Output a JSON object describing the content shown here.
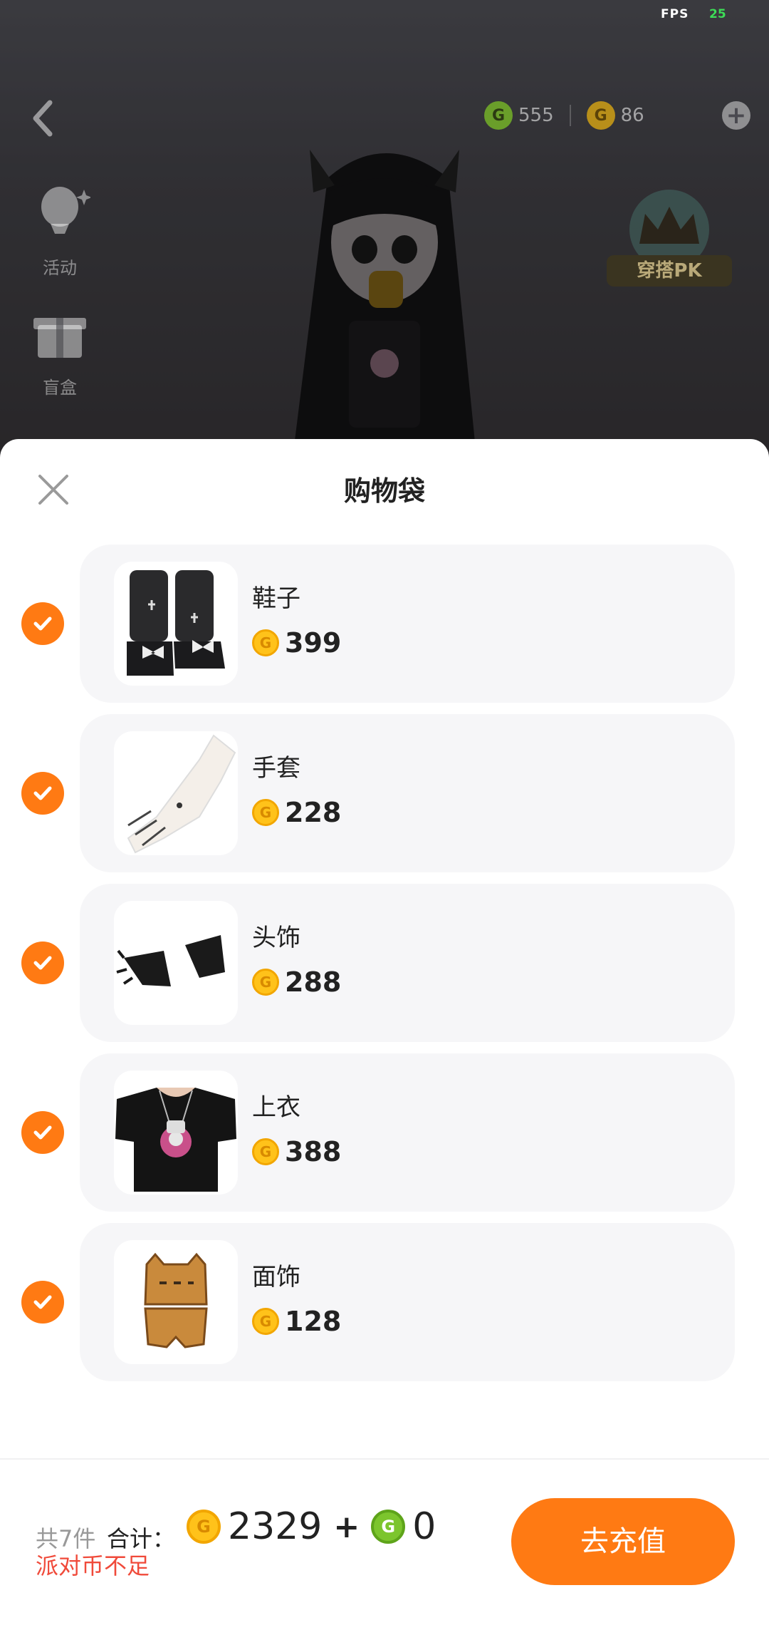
{
  "status": {
    "fps_label": "FPS",
    "fps_value": "25"
  },
  "scene": {
    "green_currency": "555",
    "gold_currency": "86",
    "side_menu": [
      {
        "label": "活动",
        "icon": "balloon-icon"
      },
      {
        "label": "盲盒",
        "icon": "gift-box-icon"
      }
    ],
    "pk_label": "穿搭PK"
  },
  "sheet": {
    "title": "购物袋",
    "items": [
      {
        "name": "鞋子",
        "price": "399",
        "checked": true,
        "thumb": "shoes-thumbnail"
      },
      {
        "name": "手套",
        "price": "228",
        "checked": true,
        "thumb": "gloves-thumbnail"
      },
      {
        "name": "头饰",
        "price": "288",
        "checked": true,
        "thumb": "cat-ears-thumbnail"
      },
      {
        "name": "上衣",
        "price": "388",
        "checked": true,
        "thumb": "shirt-thumbnail"
      },
      {
        "name": "面饰",
        "price": "128",
        "checked": true,
        "thumb": "cat-mask-thumbnail"
      }
    ]
  },
  "footer": {
    "count_text": "共7件",
    "total_label": "合计：",
    "gold_total": "2329",
    "plus": "+",
    "green_total": "0",
    "warning": "派对币不足",
    "recharge_label": "去充值"
  },
  "colors": {
    "accent": "#ff7a13",
    "warning": "#f04a3a",
    "gold": "#ffc21a",
    "green": "#7cc52d"
  }
}
